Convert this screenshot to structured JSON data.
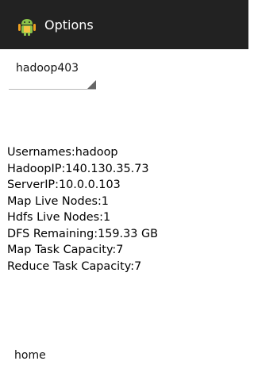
{
  "actionbar": {
    "title": "Options",
    "icon": "android-robot-icon",
    "background_color": "#222222"
  },
  "spinner": {
    "selected_value": "hadoop403"
  },
  "info": {
    "lines": [
      "Usernames:hadoop",
      "HadoopIP:140.130.35.73",
      "ServerIP:10.0.0.103",
      "Map Live Nodes:1",
      "Hdfs Live Nodes:1",
      "DFS Remaining:159.33 GB",
      "Map Task Capacity:7",
      "Reduce Task Capacity:7"
    ]
  },
  "footer": {
    "home_label": "home"
  }
}
